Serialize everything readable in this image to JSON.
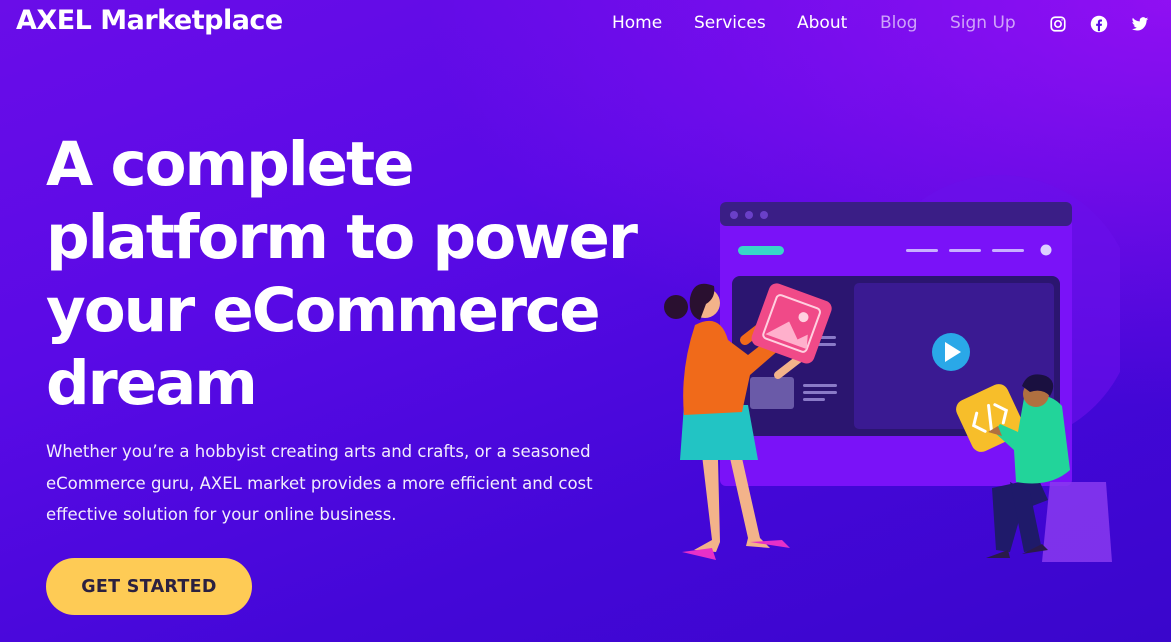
{
  "header": {
    "logo": "AXEL Marketplace",
    "nav": [
      {
        "label": "Home"
      },
      {
        "label": "Services"
      },
      {
        "label": "About"
      },
      {
        "label": "Blog"
      },
      {
        "label": "Sign Up"
      }
    ],
    "social_icons": [
      "instagram-icon",
      "facebook-icon",
      "twitter-icon"
    ]
  },
  "hero": {
    "title_lines": [
      "A complete",
      "platform to power",
      "your eCommerce",
      "dream"
    ],
    "description_lines": [
      "Whether you’re a hobbyist creating arts and crafts, or a seasoned",
      "eCommerce guru, AXEL market provides a more efficient and cost",
      "effective solution for your online business."
    ],
    "cta_label": "GET STARTED"
  },
  "colors": {
    "background_start": "#6a0de8",
    "background_end": "#3a06cc",
    "cta_background": "#fecb55",
    "cta_text": "#2b2140"
  }
}
